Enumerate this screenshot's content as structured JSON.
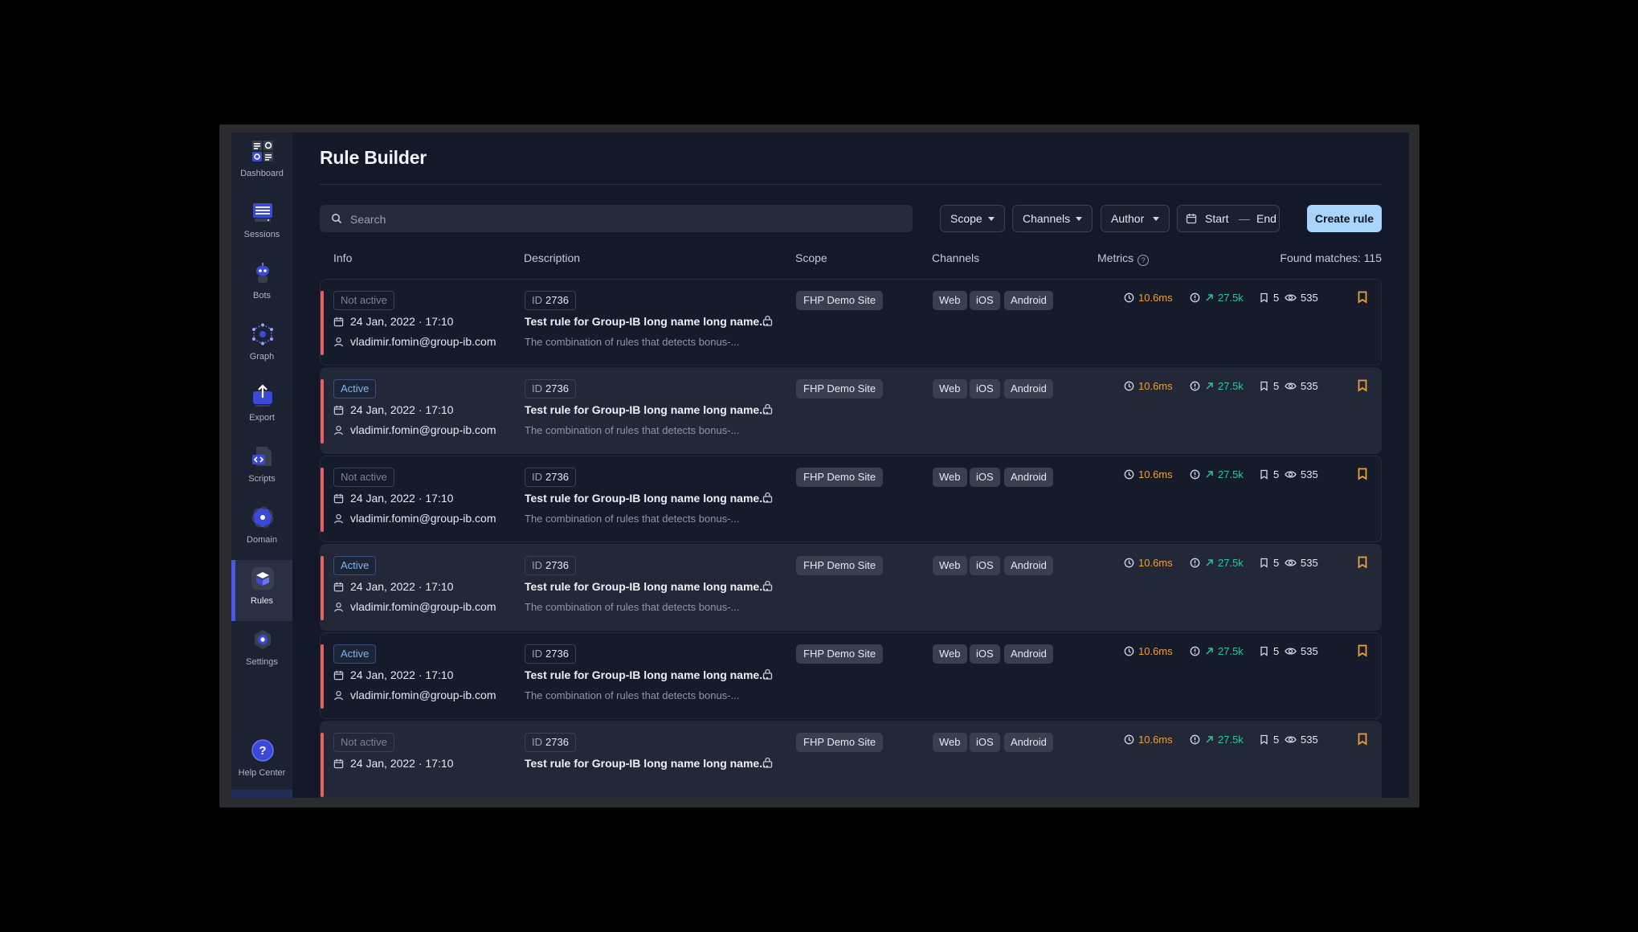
{
  "sidebar": {
    "items": [
      {
        "label": "Dashboard",
        "icon": "dashboard-icon",
        "active": false
      },
      {
        "label": "Sessions",
        "icon": "sessions-icon",
        "active": false
      },
      {
        "label": "Bots",
        "icon": "bot-icon",
        "active": false
      },
      {
        "label": "Graph",
        "icon": "graph-icon",
        "active": false
      },
      {
        "label": "Export",
        "icon": "export-icon",
        "active": false
      },
      {
        "label": "Scripts",
        "icon": "scripts-icon",
        "active": false
      },
      {
        "label": "Domain",
        "icon": "domain-icon",
        "active": false
      },
      {
        "label": "Rules",
        "icon": "rules-icon",
        "active": true
      },
      {
        "label": "Settings",
        "icon": "gear-icon",
        "active": false
      }
    ],
    "help": {
      "label": "Help Center",
      "icon": "help-icon"
    }
  },
  "page": {
    "title": "Rule Builder"
  },
  "toolbar": {
    "search_placeholder": "Search",
    "filters": {
      "scope": "Scope",
      "channels": "Channels",
      "author": "Author"
    },
    "date": {
      "start": "Start",
      "separator": "—",
      "end": "End"
    },
    "create_label": "Create rule"
  },
  "table": {
    "columns": {
      "info": "Info",
      "description": "Description",
      "scope": "Scope",
      "channels": "Channels",
      "metrics": "Metrics"
    },
    "found": "Found matches: 115",
    "rows": [
      {
        "status": "Not active",
        "active": false,
        "date": "24 Jan, 2022 · 17:10",
        "author": "vladimir.fomin@group-ib.com",
        "id_label": "ID",
        "id": "2736",
        "name": "Test rule for Group-IB long name long name...",
        "description": "The combination of rules that detects bonus-...",
        "scope": "FHP Demo Site",
        "channels": [
          "Web",
          "iOS",
          "Android"
        ],
        "time": "10.6ms",
        "alerts": "27.5k",
        "bookmarks": "5",
        "views": "535"
      },
      {
        "status": "Active",
        "active": true,
        "date": "24 Jan, 2022 · 17:10",
        "author": "vladimir.fomin@group-ib.com",
        "id_label": "ID",
        "id": "2736",
        "name": "Test rule for Group-IB long name long name...",
        "description": "The combination of rules that detects bonus-...",
        "scope": "FHP Demo Site",
        "channels": [
          "Web",
          "iOS",
          "Android"
        ],
        "time": "10.6ms",
        "alerts": "27.5k",
        "bookmarks": "5",
        "views": "535"
      },
      {
        "status": "Not active",
        "active": false,
        "date": "24 Jan, 2022 · 17:10",
        "author": "vladimir.fomin@group-ib.com",
        "id_label": "ID",
        "id": "2736",
        "name": "Test rule for Group-IB long name long name...",
        "description": "The combination of rules that detects bonus-...",
        "scope": "FHP Demo Site",
        "channels": [
          "Web",
          "iOS",
          "Android"
        ],
        "time": "10.6ms",
        "alerts": "27.5k",
        "bookmarks": "5",
        "views": "535"
      },
      {
        "status": "Active",
        "active": true,
        "date": "24 Jan, 2022 · 17:10",
        "author": "vladimir.fomin@group-ib.com",
        "id_label": "ID",
        "id": "2736",
        "name": "Test rule for Group-IB long name long name...",
        "description": "The combination of rules that detects bonus-...",
        "scope": "FHP Demo Site",
        "channels": [
          "Web",
          "iOS",
          "Android"
        ],
        "time": "10.6ms",
        "alerts": "27.5k",
        "bookmarks": "5",
        "views": "535"
      },
      {
        "status": "Active",
        "active": true,
        "date": "24 Jan, 2022 · 17:10",
        "author": "vladimir.fomin@group-ib.com",
        "id_label": "ID",
        "id": "2736",
        "name": "Test rule for Group-IB long name long name...",
        "description": "The combination of rules that detects bonus-...",
        "scope": "FHP Demo Site",
        "channels": [
          "Web",
          "iOS",
          "Android"
        ],
        "time": "10.6ms",
        "alerts": "27.5k",
        "bookmarks": "5",
        "views": "535"
      },
      {
        "status": "Not active",
        "active": false,
        "date": "24 Jan, 2022 · 17:10",
        "author": "",
        "id_label": "ID",
        "id": "2736",
        "name": "Test rule for Group-IB long name long name...",
        "description": "",
        "scope": "FHP Demo Site",
        "channels": [
          "Web",
          "iOS",
          "Android"
        ],
        "time": "10.6ms",
        "alerts": "27.5k",
        "bookmarks": "5",
        "views": "535"
      }
    ]
  },
  "colors": {
    "accent": "#4b55e6",
    "primary_button": "#a9d4fb",
    "status_bar": "#e8615f",
    "metric_time": "#f0a030",
    "metric_alerts": "#2bc5a5",
    "bookmark": "#f0a030"
  }
}
